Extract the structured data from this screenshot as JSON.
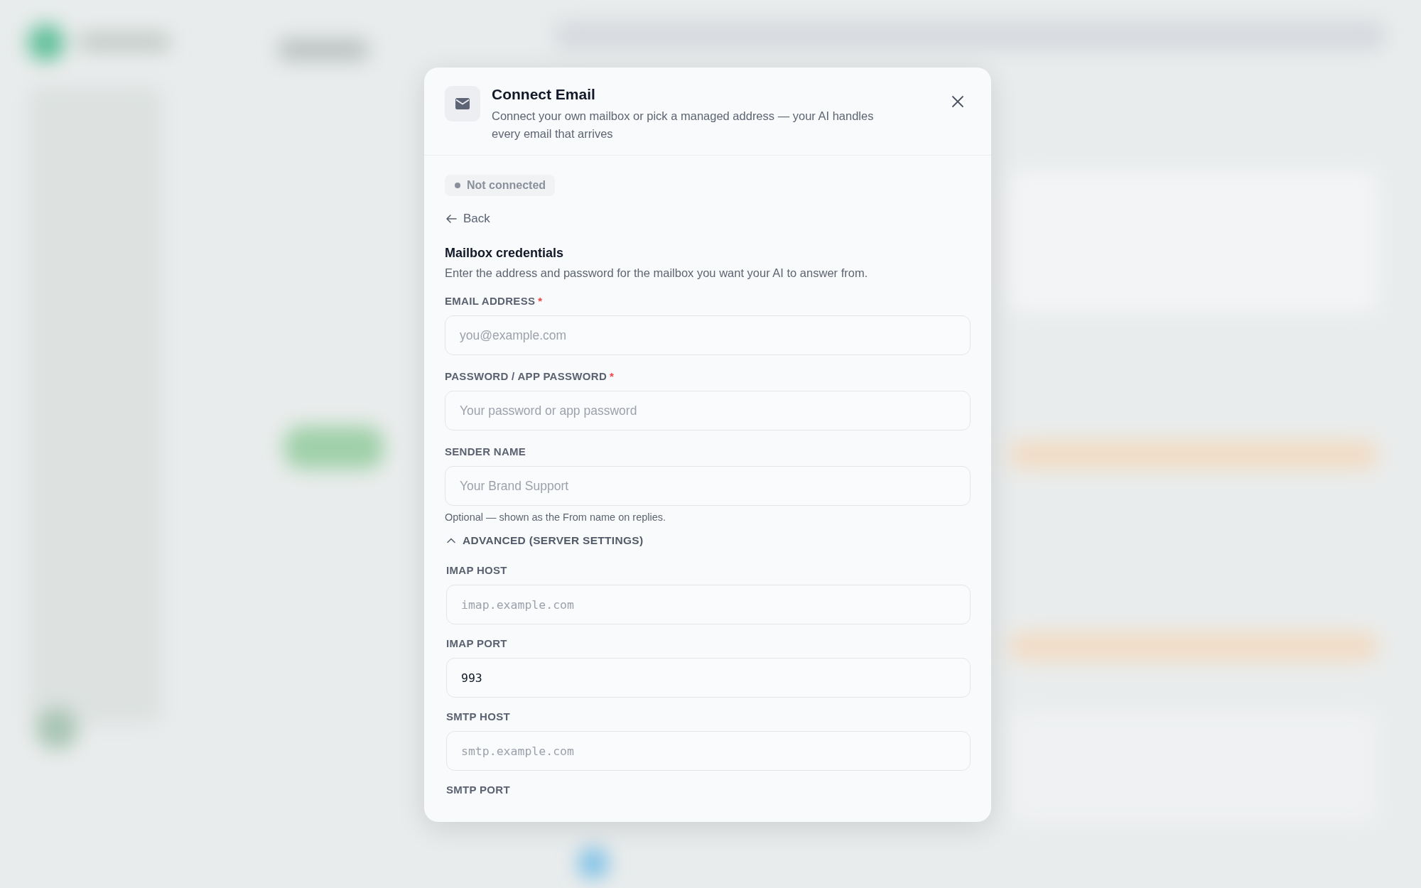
{
  "dialog": {
    "title": "Connect Email",
    "subtitle": "Connect your own mailbox or pick a managed address — your AI handles every email that arrives"
  },
  "status": {
    "label": "Not connected",
    "connected": false
  },
  "back": {
    "label": "Back"
  },
  "section": {
    "title": "Mailbox credentials",
    "description": "Enter the address and password for the mailbox you want your AI to answer from."
  },
  "fields": [
    {
      "label": "EMAIL ADDRESS",
      "required_mark": "*",
      "placeholder": "you@example.com"
    },
    {
      "label": "PASSWORD / APP PASSWORD",
      "required_mark": "*",
      "placeholder": "Your password or app password"
    },
    {
      "label": "SENDER NAME",
      "placeholder": "Your Brand Support",
      "help": "Optional — shown as the From name on replies."
    }
  ],
  "advanced": {
    "label": "ADVANCED (SERVER SETTINGS)",
    "expanded": true,
    "fields": [
      {
        "label": "IMAP HOST",
        "placeholder": "imap.example.com",
        "kind": "mono"
      },
      {
        "label": "IMAP PORT",
        "value": "993",
        "kind": "mono"
      },
      {
        "label": "SMTP HOST",
        "placeholder": "smtp.example.com",
        "kind": "mono"
      },
      {
        "label": "SMTP PORT",
        "kind": "label_only"
      }
    ]
  }
}
